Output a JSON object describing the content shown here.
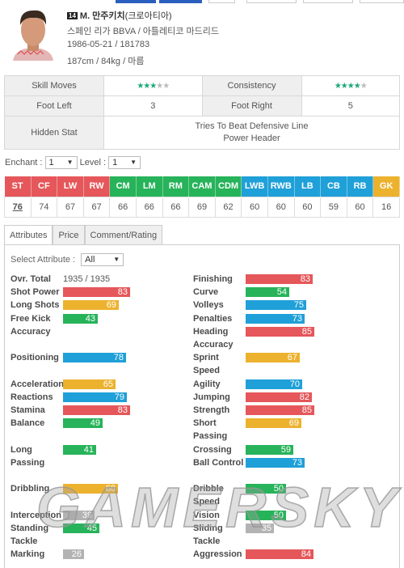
{
  "player": {
    "ovr_badge": "14",
    "name": "M. 만주키치",
    "nation": "(크로아티아)",
    "league_team": "스페인 리가 BBVA / 아틀레티코 마드리드",
    "birth_id": "1986-05-21 / 181783",
    "body": "187cm / 84kg / 마름"
  },
  "info": {
    "skill_moves_label": "Skill Moves",
    "skill_moves_stars": 3,
    "consistency_label": "Consistency",
    "consistency_stars": 4,
    "foot_left_label": "Foot Left",
    "foot_left": "3",
    "foot_right_label": "Foot Right",
    "foot_right": "5",
    "hidden_stat_label": "Hidden Stat",
    "hidden_stats": [
      "Tries To Beat Defensive Line",
      "Power Header"
    ]
  },
  "controls": {
    "enchant_label": "Enchant :",
    "enchant_value": "1",
    "level_label": "Level :",
    "level_value": "1"
  },
  "positions": [
    {
      "pos": "ST",
      "val": "76",
      "group": "att"
    },
    {
      "pos": "CF",
      "val": "74",
      "group": "att"
    },
    {
      "pos": "LW",
      "val": "67",
      "group": "att"
    },
    {
      "pos": "RW",
      "val": "67",
      "group": "att"
    },
    {
      "pos": "CM",
      "val": "66",
      "group": "mid"
    },
    {
      "pos": "LM",
      "val": "66",
      "group": "mid"
    },
    {
      "pos": "RM",
      "val": "66",
      "group": "mid"
    },
    {
      "pos": "CAM",
      "val": "69",
      "group": "mid"
    },
    {
      "pos": "CDM",
      "val": "62",
      "group": "mid"
    },
    {
      "pos": "LWB",
      "val": "60",
      "group": "def"
    },
    {
      "pos": "RWB",
      "val": "60",
      "group": "def"
    },
    {
      "pos": "LB",
      "val": "60",
      "group": "def"
    },
    {
      "pos": "CB",
      "val": "59",
      "group": "def"
    },
    {
      "pos": "RB",
      "val": "60",
      "group": "def"
    },
    {
      "pos": "GK",
      "val": "16",
      "group": "gk"
    }
  ],
  "group_colors": {
    "att": "#e5575a",
    "mid": "#27b35a",
    "def": "#1fa0d8",
    "gk": "#ecb22e"
  },
  "tabs": [
    {
      "label": "Attributes",
      "active": true
    },
    {
      "label": "Price"
    },
    {
      "label": "Comment/Rating"
    }
  ],
  "attributes": {
    "select_label": "Select Attribute :",
    "select_value": "All",
    "ovr_total_label": "Ovr. Total",
    "ovr_total_value": "1935 / 1935",
    "left": [
      {
        "label": "Shot Power",
        "value": 83
      },
      {
        "label": "Long Shots",
        "value": 69
      },
      {
        "label": "Free Kick Accuracy",
        "value": 43
      },
      {
        "label": "Positioning",
        "value": 78
      },
      {
        "label": "Acceleration",
        "value": 65
      },
      {
        "label": "Reactions",
        "value": 79
      },
      {
        "label": "Stamina",
        "value": 83
      },
      {
        "label": "Balance",
        "value": 49
      },
      {
        "label": "Long Passing",
        "value": 41
      },
      {
        "label": "Dribbling",
        "value": 68
      },
      {
        "label": "Interception",
        "value": 39
      },
      {
        "label": "Standing Tackle",
        "value": 45
      },
      {
        "label": "Marking",
        "value": 26
      }
    ],
    "right": [
      {
        "label": "Finishing",
        "value": 83
      },
      {
        "label": "Curve",
        "value": 54
      },
      {
        "label": "Volleys",
        "value": 75
      },
      {
        "label": "Penalties",
        "value": 73
      },
      {
        "label": "Heading Accuracy",
        "value": 85
      },
      {
        "label": "Sprint Speed",
        "value": 67
      },
      {
        "label": "Agility",
        "value": 70
      },
      {
        "label": "Jumping",
        "value": 82
      },
      {
        "label": "Strength",
        "value": 85
      },
      {
        "label": "Short Passing",
        "value": 69
      },
      {
        "label": "Crossing",
        "value": 59
      },
      {
        "label": "Ball Control",
        "value": 73
      },
      {
        "label": "Dribble Speed",
        "value": 50
      },
      {
        "label": "Vision",
        "value": 50
      },
      {
        "label": "Sliding Tackle",
        "value": 35
      },
      {
        "label": "Aggression",
        "value": 84
      }
    ]
  },
  "rating_colors": {
    "80+": "#e5575a",
    "70+": "#1fa0d8",
    "60+": "#ecb22e",
    "40+": "#27b35a",
    "low": "#b3b3b3"
  },
  "watermark": "GAMERSKY"
}
